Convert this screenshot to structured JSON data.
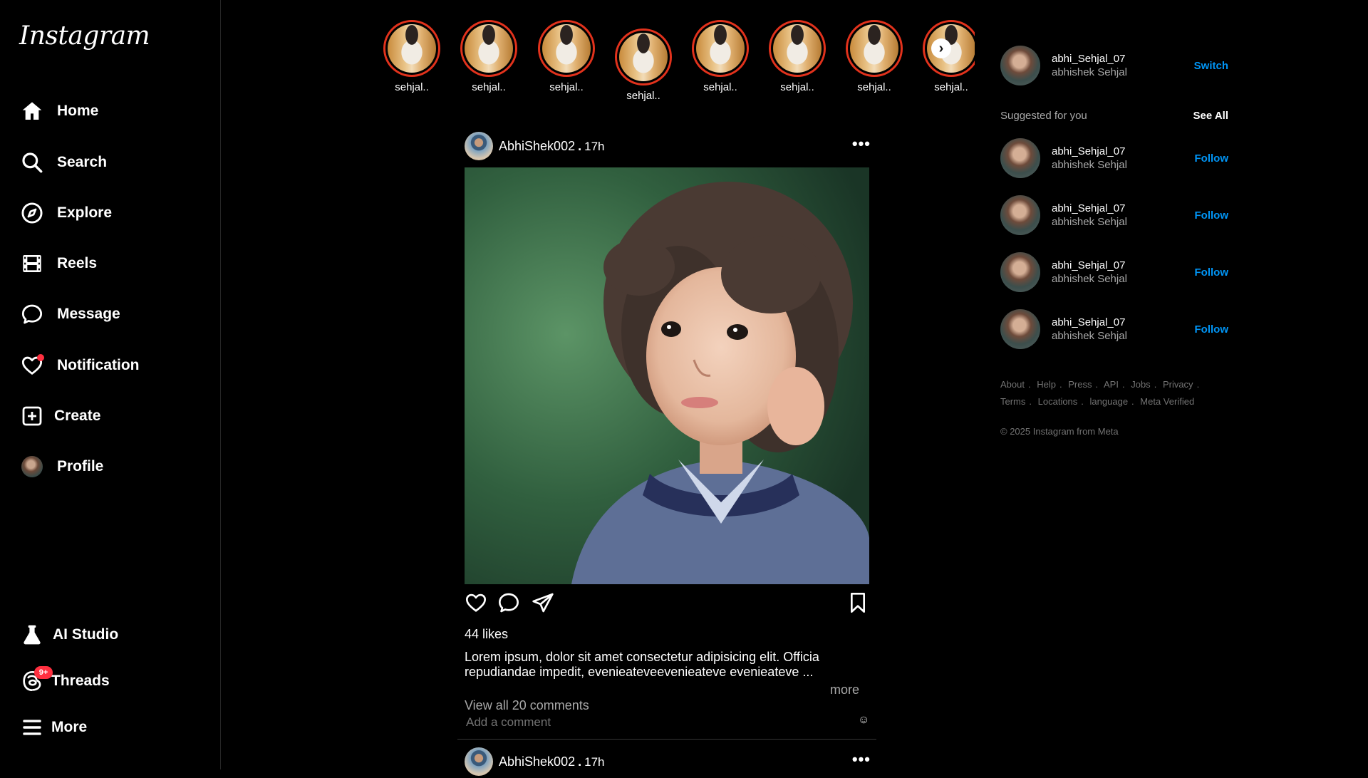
{
  "sidebar": {
    "logo": "Instagram",
    "items": [
      {
        "label": "Home"
      },
      {
        "label": "Search"
      },
      {
        "label": "Explore"
      },
      {
        "label": "Reels"
      },
      {
        "label": "Message"
      },
      {
        "label": "Notification"
      },
      {
        "label": "Create"
      },
      {
        "label": "Profile"
      }
    ],
    "bottom_items": [
      {
        "label": "AI Studio"
      },
      {
        "label": "Threads",
        "badge": "9+"
      },
      {
        "label": "More"
      }
    ]
  },
  "stories": [
    {
      "name": "sehjal.."
    },
    {
      "name": "sehjal.."
    },
    {
      "name": "sehjal.."
    },
    {
      "name": "sehjal.."
    },
    {
      "name": "sehjal.."
    },
    {
      "name": "sehjal.."
    },
    {
      "name": "sehjal.."
    },
    {
      "name": "sehjal.."
    }
  ],
  "post": {
    "username": "AbhiShek002",
    "separator": ".",
    "time": "17h",
    "likes": "44 likes",
    "caption": "Lorem ipsum, dolor sit amet consectetur adipisicing elit. Officia repudiandae impedit, evenieateveevenieateve evenieateve ...",
    "more": "more",
    "view_comments": "View all 20 comments",
    "add_comment_placeholder": "Add a comment",
    "emoji": "☺"
  },
  "post2": {
    "username": "AbhiShek002",
    "separator": ".",
    "time": "17h"
  },
  "right": {
    "current_account": {
      "username": "abhi_Sehjal_07",
      "name": "abhishek Sehjal",
      "action": "Switch"
    },
    "suggested_title": "Suggested for you",
    "see_all": "See All",
    "suggestions": [
      {
        "username": "abhi_Sehjal_07",
        "name": "abhishek Sehjal",
        "action": "Follow"
      },
      {
        "username": "abhi_Sehjal_07",
        "name": "abhishek Sehjal",
        "action": "Follow"
      },
      {
        "username": "abhi_Sehjal_07",
        "name": "abhishek Sehjal",
        "action": "Follow"
      },
      {
        "username": "abhi_Sehjal_07",
        "name": "abhishek Sehjal",
        "action": "Follow"
      }
    ],
    "footer_links_row1": [
      "About",
      "Help",
      "Press",
      "API",
      "Jobs",
      "Privacy"
    ],
    "footer_links_row2": [
      "Terms",
      "Locations",
      "language",
      "Meta Verified"
    ],
    "copyright": "© 2025 Instagram from Meta"
  },
  "colors": {
    "background": "#000000",
    "story_ring": "#e2321c",
    "link_blue": "#0095f6",
    "badge_red": "#ff3040",
    "muted_text": "#a8a8a8"
  }
}
